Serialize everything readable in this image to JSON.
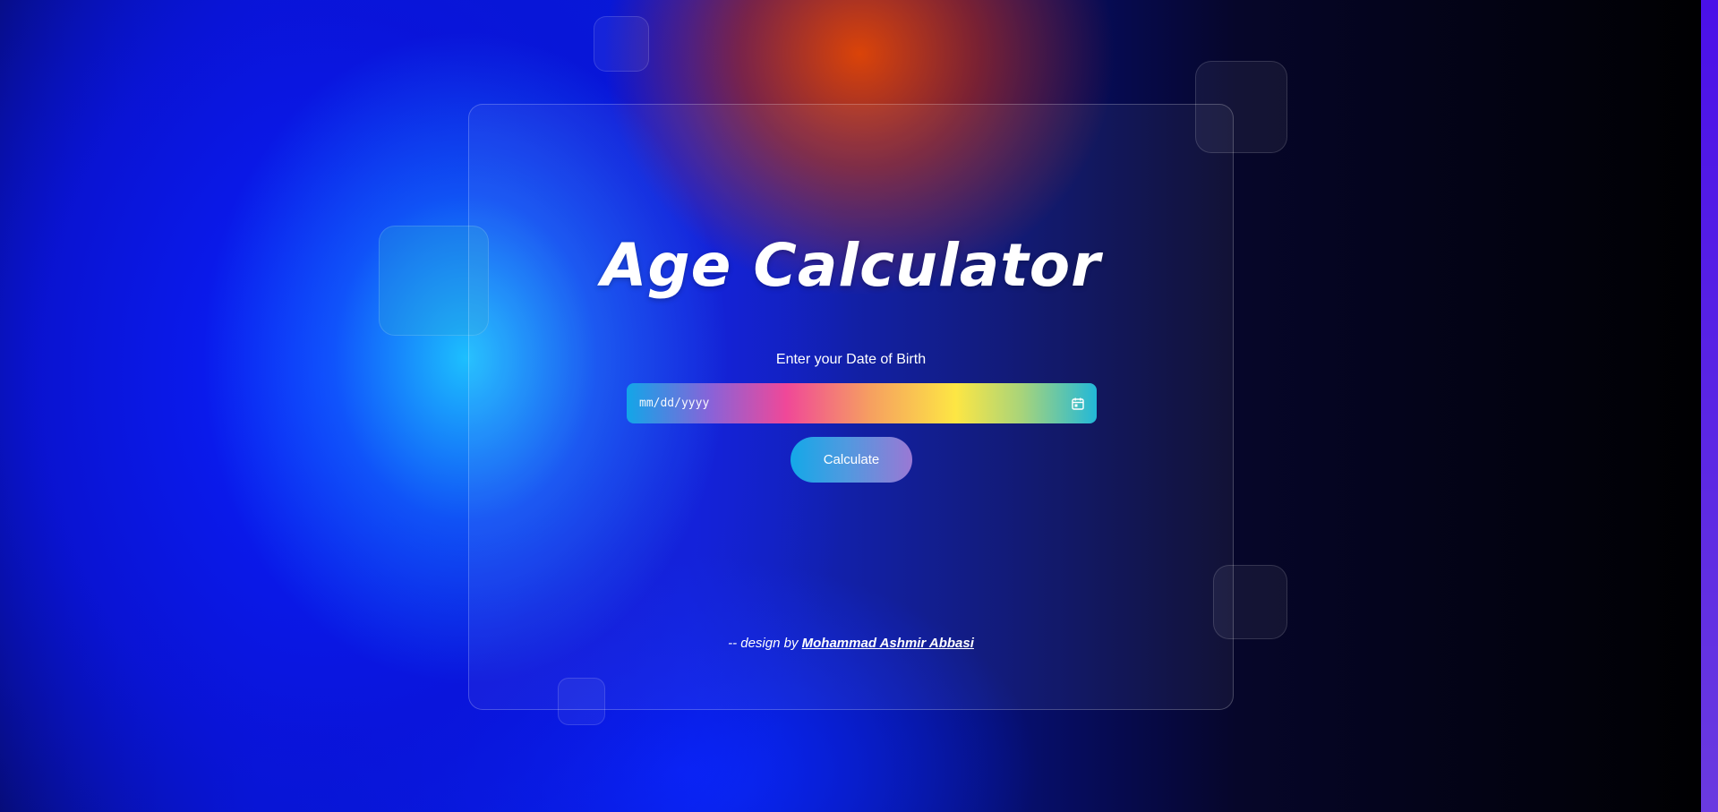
{
  "app": {
    "title": "Age Calculator",
    "dob_label": "Enter your Date of Birth",
    "date_input": {
      "placeholder": "mm/dd/yyyy",
      "value": ""
    },
    "calculate_label": "Calculate",
    "footer": {
      "prefix": "-- design by ",
      "author": "Mohammad Ashmir Abbasi"
    }
  },
  "icons": {
    "calendar": "calendar-icon"
  },
  "colors": {
    "title": "#ffffff",
    "button_start": "#14a8e8",
    "button_end": "#9a78d4"
  }
}
